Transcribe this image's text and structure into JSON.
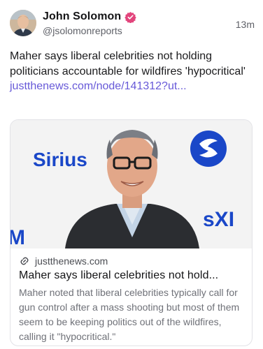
{
  "post": {
    "author_name": "John Solomon",
    "author_handle": "@jsolomonreports",
    "timestamp": "13m",
    "verified_badge_color": "#e2457c",
    "text": "Maher says liberal celebrities not holding politicians accountable for wildfires 'hypocritical'",
    "link_text": "justthenews.com/node/141312?ut...",
    "link_color": "#6759d8"
  },
  "link_card": {
    "domain": "justthenews.com",
    "title": "Maher says liberal celebrities not hold...",
    "description": "Maher noted that liberal celebrities typically call for gun control after a mass shooting but most of them seem to be keeping politics out of the wildfires, calling it \"hypocritical.\"",
    "backdrop_text_left": "Sirius",
    "backdrop_text_right": "sXI",
    "backdrop_text_bottom_left": "M"
  },
  "icons": {
    "verified": "verified-badge-icon",
    "link": "link-icon"
  }
}
